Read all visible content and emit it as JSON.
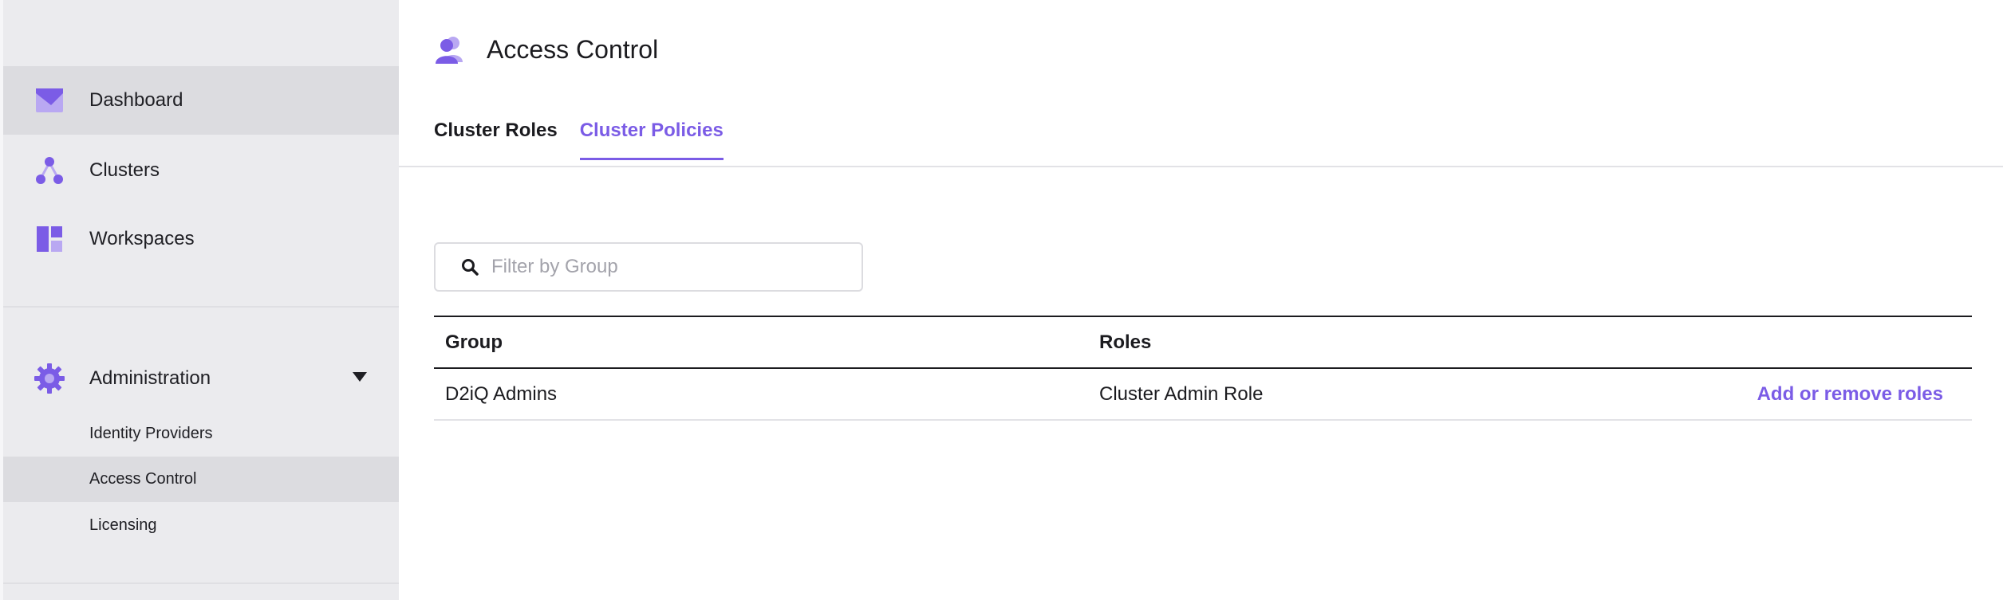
{
  "colors": {
    "accent": "#7b5ce6",
    "icon_purple": "#7b5ce6",
    "icon_purple_light": "#b9a8f2",
    "sidebar_bg": "#ebebee",
    "sidebar_active_bg": "#dcdce0"
  },
  "sidebar": {
    "items": [
      {
        "label": "Dashboard",
        "icon": "dashboard-icon",
        "active": true
      },
      {
        "label": "Clusters",
        "icon": "clusters-icon"
      },
      {
        "label": "Workspaces",
        "icon": "workspaces-icon"
      }
    ],
    "administration": {
      "label": "Administration",
      "icon": "gear-icon",
      "expanded": true,
      "subitems": [
        {
          "label": "Identity Providers"
        },
        {
          "label": "Access Control",
          "active": true
        },
        {
          "label": "Licensing"
        }
      ]
    }
  },
  "page": {
    "title": "Access Control",
    "icon": "users-icon",
    "tabs": [
      {
        "label": "Cluster Roles",
        "active": false
      },
      {
        "label": "Cluster Policies",
        "active": true
      }
    ],
    "filter": {
      "placeholder": "Filter by Group",
      "value": "",
      "icon": "search-icon"
    }
  },
  "table": {
    "columns": [
      "Group",
      "Roles"
    ],
    "rows": [
      {
        "group": "D2iQ Admins",
        "roles": "Cluster Admin Role",
        "action": "Add or remove roles"
      }
    ]
  }
}
